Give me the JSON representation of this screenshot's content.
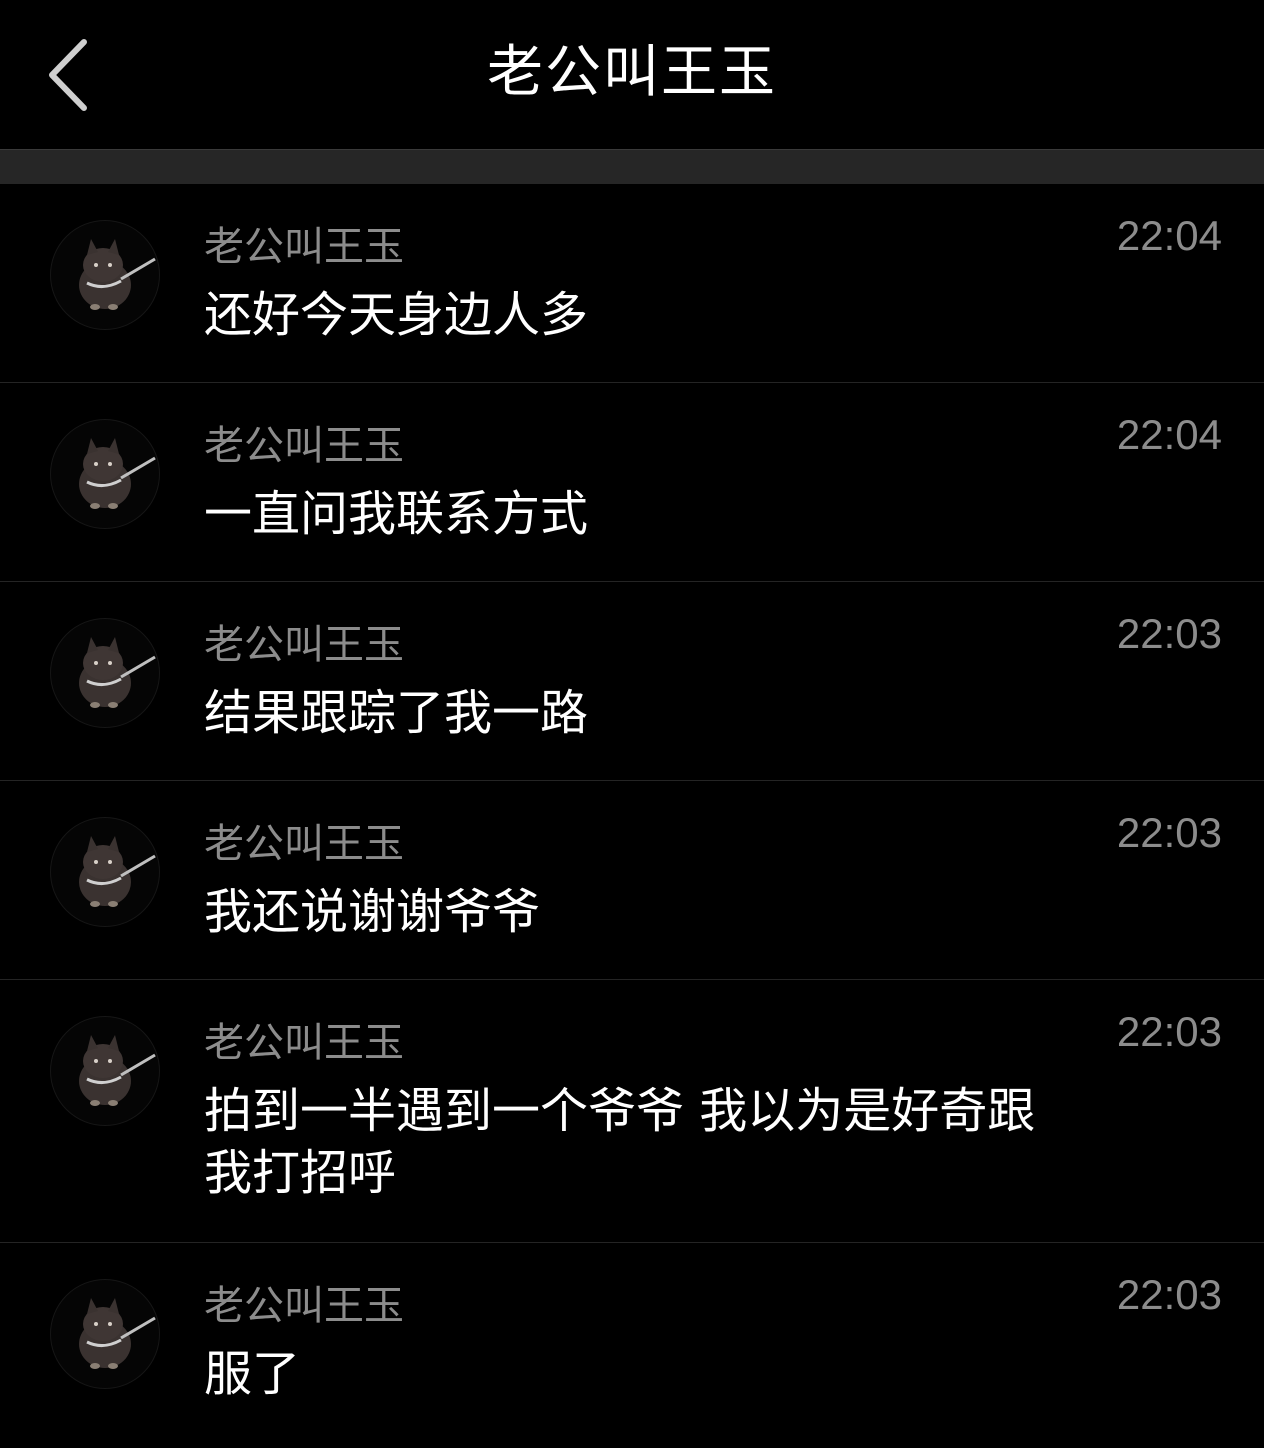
{
  "header": {
    "title": "老公叫王玉",
    "back_icon": "chevron-left-icon"
  },
  "colors": {
    "background": "#000000",
    "band": "#262626",
    "secondary_text": "#8c8c8c",
    "primary_text": "#ffffff"
  },
  "messages": [
    {
      "sender": "老公叫王玉",
      "text": "还好今天身边人多",
      "time": "22:04",
      "avatar_icon": "dog-avatar-icon"
    },
    {
      "sender": "老公叫王玉",
      "text": "一直问我联系方式",
      "time": "22:04",
      "avatar_icon": "dog-avatar-icon"
    },
    {
      "sender": "老公叫王玉",
      "text": "结果跟踪了我一路",
      "time": "22:03",
      "avatar_icon": "dog-avatar-icon"
    },
    {
      "sender": "老公叫王玉",
      "text": "我还说谢谢爷爷",
      "time": "22:03",
      "avatar_icon": "dog-avatar-icon"
    },
    {
      "sender": "老公叫王玉",
      "text": "拍到一半遇到一个爷爷 我以为是好奇跟我打招呼",
      "time": "22:03",
      "avatar_icon": "dog-avatar-icon"
    },
    {
      "sender": "老公叫王玉",
      "text": "服了",
      "time": "22:03",
      "avatar_icon": "dog-avatar-icon"
    }
  ]
}
